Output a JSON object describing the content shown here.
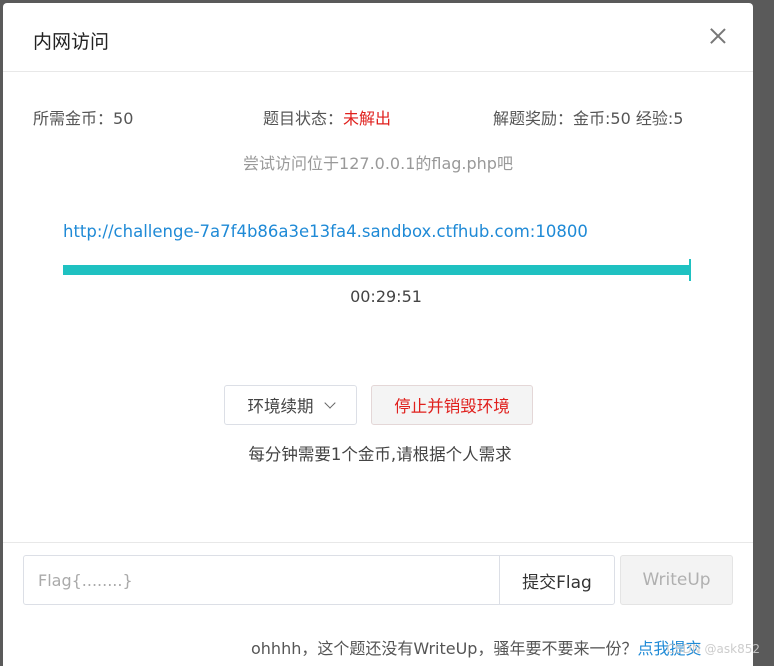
{
  "modal": {
    "title": "内网访问"
  },
  "info": {
    "coins_label": "所需金币：",
    "coins_value": "50",
    "status_label": "题目状态：",
    "status_value": "未解出",
    "reward_text": "解题奖励：金币:50 经验:5"
  },
  "hint": "尝试访问位于127.0.0.1的flag.php吧",
  "environment": {
    "url": "http://challenge-7a7f4b86a3e13fa4.sandbox.ctfhub.com:10800",
    "progress_percent": 100,
    "timer": "00:29:51"
  },
  "actions": {
    "renew_label": "环境续期",
    "destroy_label": "停止并销毁环境",
    "cost_note": "每分钟需要1个金币,请根据个人需求"
  },
  "flag_form": {
    "input_placeholder": "Flag{........}",
    "input_value": "",
    "submit_label": "提交Flag",
    "writeup_label": "WriteUp"
  },
  "footer": {
    "note": "ohhhh，这个题还没有WriteUp，骚年要不要来一份？",
    "link_label": "点我提交"
  },
  "watermark": "CSDN @ask852",
  "colors": {
    "accent": "#1fc1c1",
    "link": "#1f8ad6",
    "danger": "#e0201d"
  }
}
